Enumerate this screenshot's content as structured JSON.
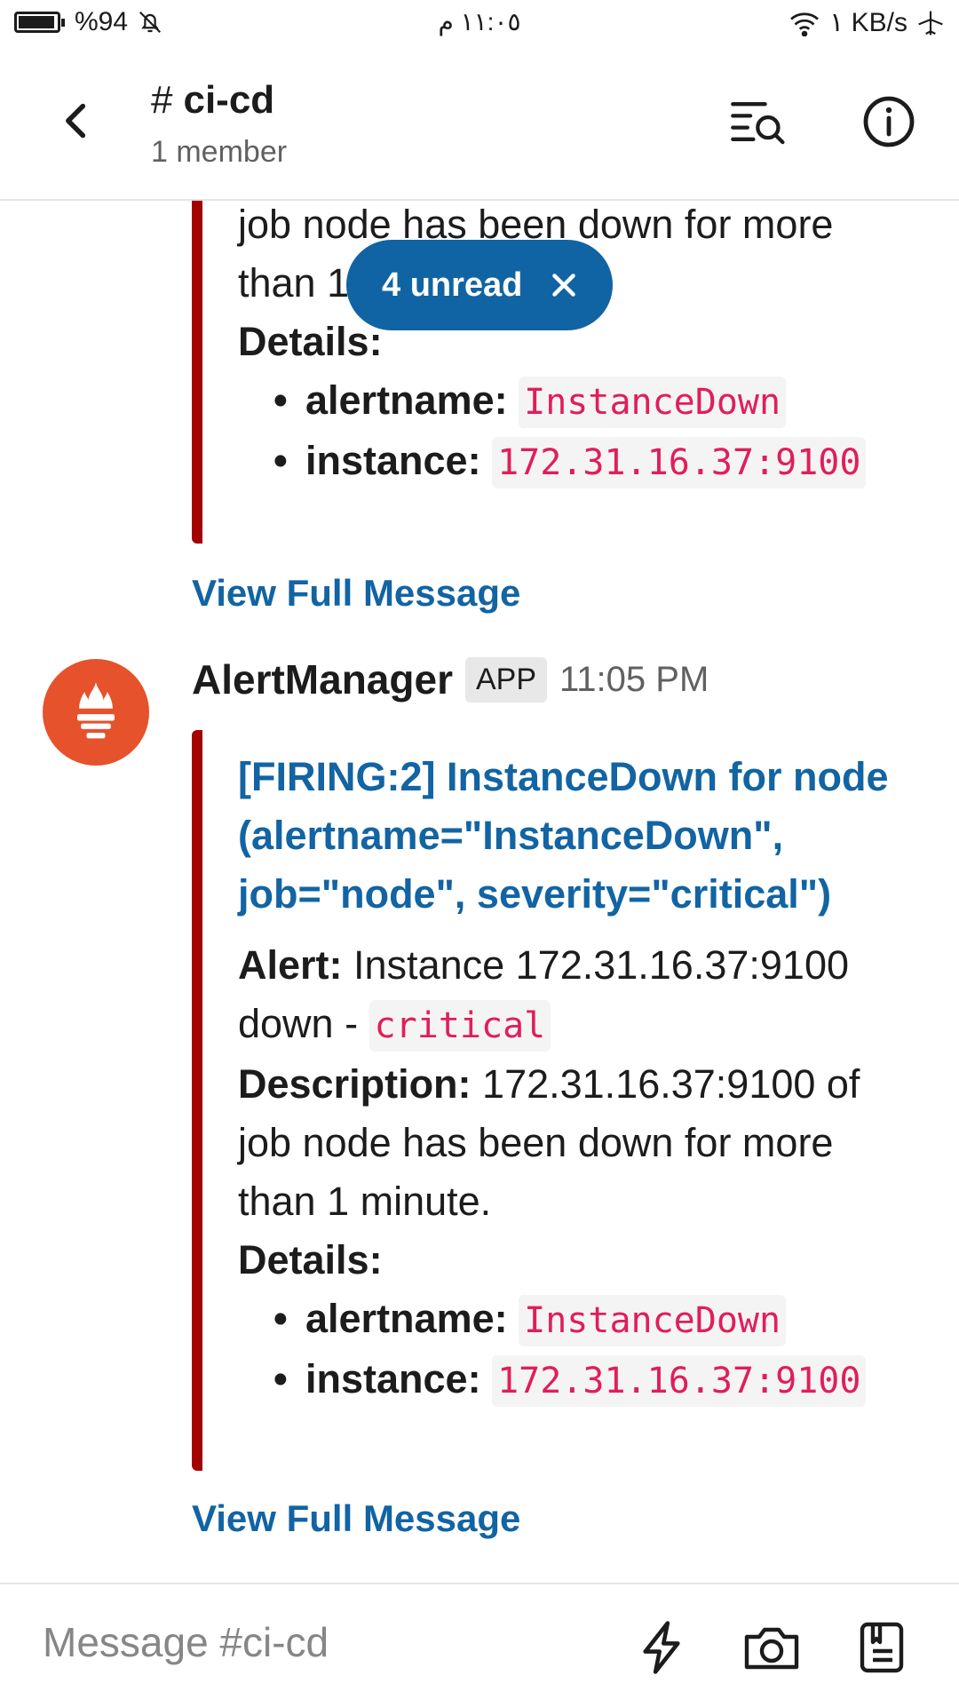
{
  "status_bar": {
    "battery": "%94",
    "time": "١١:٠٥ م",
    "network": "١ KB/s"
  },
  "header": {
    "hash": "#",
    "channel": "ci-cd",
    "members": "1 member"
  },
  "unread_pill": {
    "label": "4 unread"
  },
  "first_message": {
    "lines": [
      "job node has been down for more",
      "than 1"
    ],
    "details_label": "Details:",
    "details": [
      {
        "key": "alertname:",
        "value": "InstanceDown"
      },
      {
        "key": "instance:",
        "value": "172.31.16.37:9100"
      }
    ],
    "view_full": "View Full Message"
  },
  "second_message": {
    "sender": "AlertManager",
    "badge": "APP",
    "time": "11:05 PM",
    "title_lines": [
      "[FIRING:2] InstanceDown for node",
      "(alertname=\"InstanceDown\",",
      "job=\"node\", severity=\"critical\")"
    ],
    "alert_label": "Alert:",
    "alert_text": "Instance 172.31.16.37:9100",
    "alert_text2": "down -",
    "alert_severity": "critical",
    "description_label": "Description:",
    "description_text": "172.31.16.37:9100 of",
    "description_lines": [
      "job node has been down for more",
      "than 1 minute."
    ],
    "details_label": "Details:",
    "details": [
      {
        "key": "alertname:",
        "value": "InstanceDown"
      },
      {
        "key": "instance:",
        "value": "172.31.16.37:9100"
      }
    ],
    "view_full": "View Full Message"
  },
  "composer": {
    "placeholder": "Message #ci-cd"
  },
  "colors": {
    "link": "#1264a3",
    "attachment_bar": "#a30200",
    "code": "#e01e5a",
    "pill": "#1164a3",
    "avatar": "#e6522c"
  },
  "icons": {
    "back": "chevron-left-icon",
    "search": "search-messages-icon",
    "info": "info-icon",
    "close": "close-icon",
    "shortcuts": "lightning-icon",
    "camera": "camera-icon",
    "files": "files-icon"
  }
}
